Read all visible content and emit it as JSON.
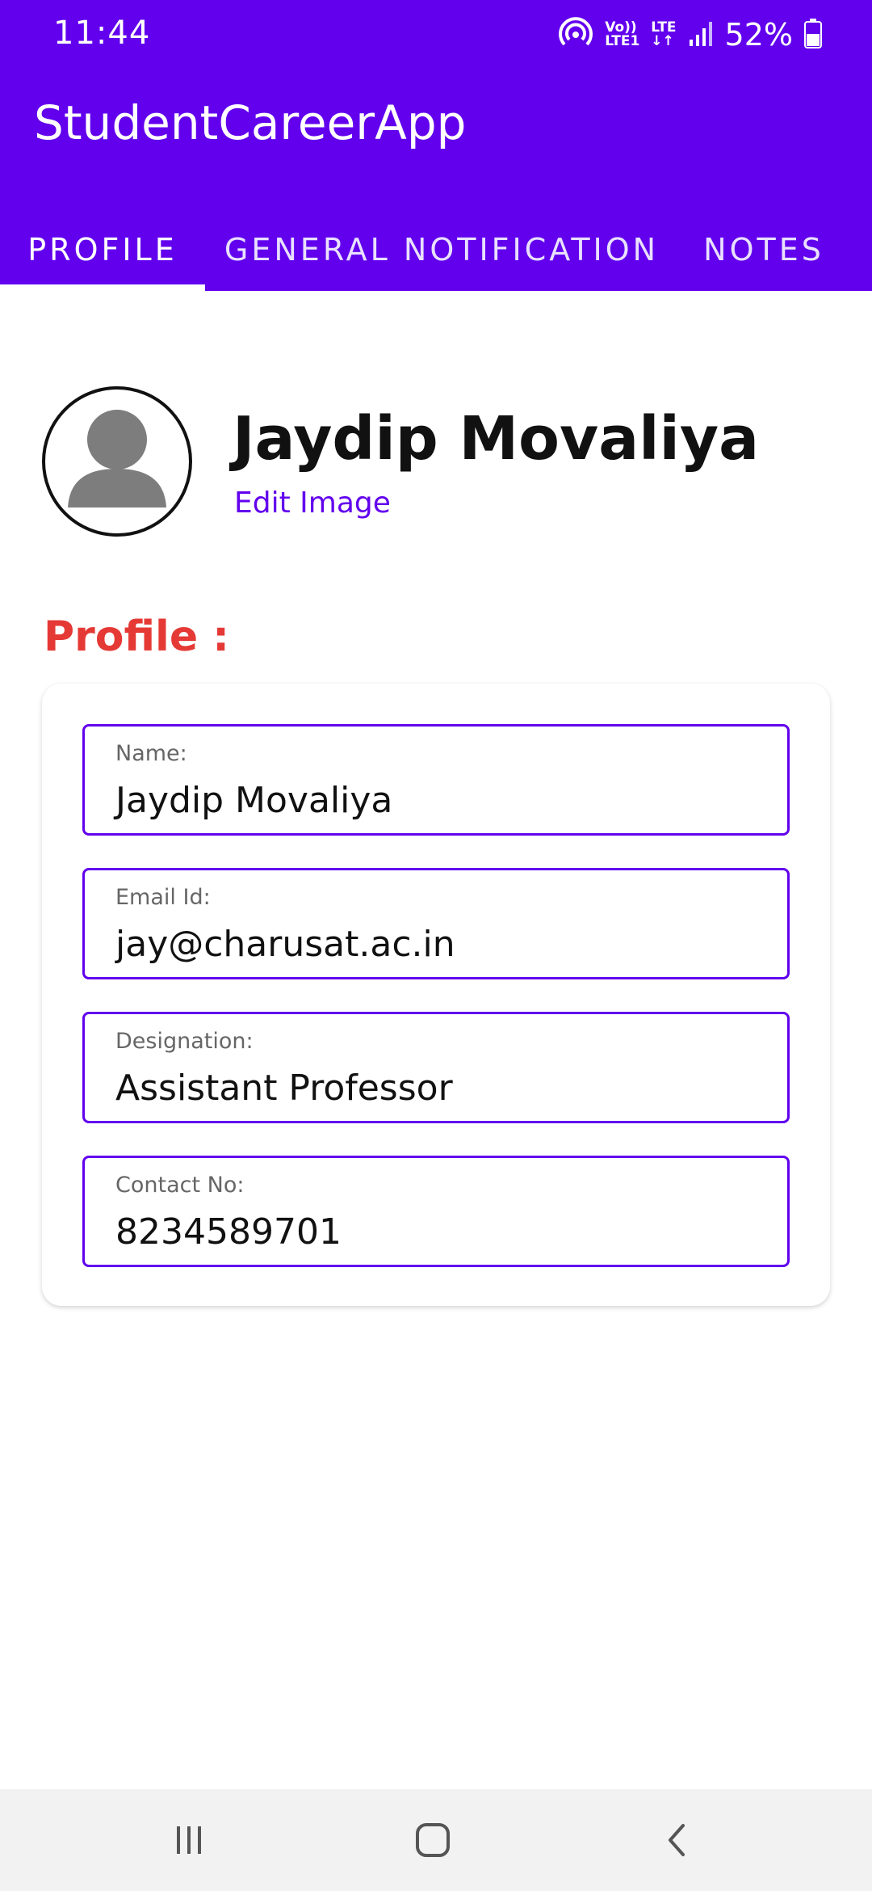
{
  "status_bar": {
    "time": "11:44",
    "battery": "52%",
    "network_top": "Vo))",
    "network_bottom": "LTE1",
    "lte_top": "LTE",
    "lte_bottom": "↓↑"
  },
  "app": {
    "title": "StudentCareerApp",
    "accent": "#6200EE",
    "section_color": "#E53935"
  },
  "tabs": [
    {
      "label": "PROFILE",
      "active": true
    },
    {
      "label": "GENERAL NOTIFICATION",
      "active": false
    },
    {
      "label": "NOTES",
      "active": false
    }
  ],
  "profile_header": {
    "name": "Jaydip Movaliya",
    "edit_image": "Edit Image"
  },
  "section": {
    "title": "Profile :"
  },
  "fields": [
    {
      "label": "Name:",
      "value": "Jaydip Movaliya"
    },
    {
      "label": "Email Id:",
      "value": "jay@charusat.ac.in"
    },
    {
      "label": "Designation:",
      "value": "Assistant Professor"
    },
    {
      "label": "Contact No:",
      "value": "8234589701"
    }
  ],
  "icons": {
    "avatar": "person-icon",
    "recent": "recent-apps-icon",
    "home": "home-icon",
    "back": "back-icon"
  }
}
